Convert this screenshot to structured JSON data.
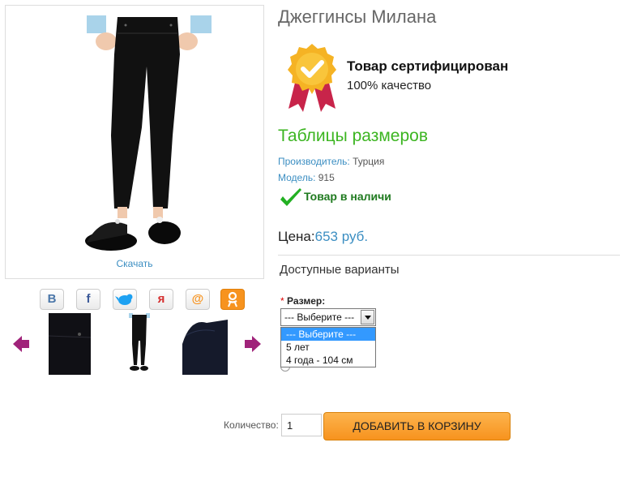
{
  "product": {
    "title": "Джеггинсы Милана",
    "download_label": "Скачать",
    "certified_title": "Товар сертифицирован",
    "certified_sub": "100% качество",
    "size_table_link": "Таблицы размеров",
    "manufacturer_label": "Производитель:",
    "manufacturer_value": "Турция",
    "model_label": "Модель:",
    "model_value": "915",
    "stock_text": "Товар в наличи",
    "price_label": "Цена:",
    "price_value": "653 руб."
  },
  "social": [
    {
      "icon": "vkontakte-icon",
      "glyph": "В",
      "color": "#4a76a8"
    },
    {
      "icon": "facebook-icon",
      "glyph": "f",
      "color": "#3b5998"
    },
    {
      "icon": "twitter-icon",
      "glyph": "🐦",
      "color": "#1da1f2"
    },
    {
      "icon": "yaru-icon",
      "glyph": "я",
      "color": "#d52e2e"
    },
    {
      "icon": "mailru-icon",
      "glyph": "@",
      "color": "#f7931e"
    },
    {
      "icon": "odnoklassniki-icon",
      "glyph": "ок",
      "color": "#f7931e"
    }
  ],
  "options": {
    "heading": "Доступные варианты",
    "required_mark": "*",
    "size_label": "Размер:",
    "selected": "--- Выберите ---",
    "items": [
      "--- Выберите ---",
      "5 лет",
      "4 года - 104 см"
    ]
  },
  "cart": {
    "qty_label": "Количество:",
    "qty_value": "1",
    "add_button": "ДОБАВИТЬ В КОРЗИНУ"
  },
  "colors": {
    "accent_blue": "#3b8ec2",
    "green": "#3cb521",
    "orange": "#f7931e"
  }
}
